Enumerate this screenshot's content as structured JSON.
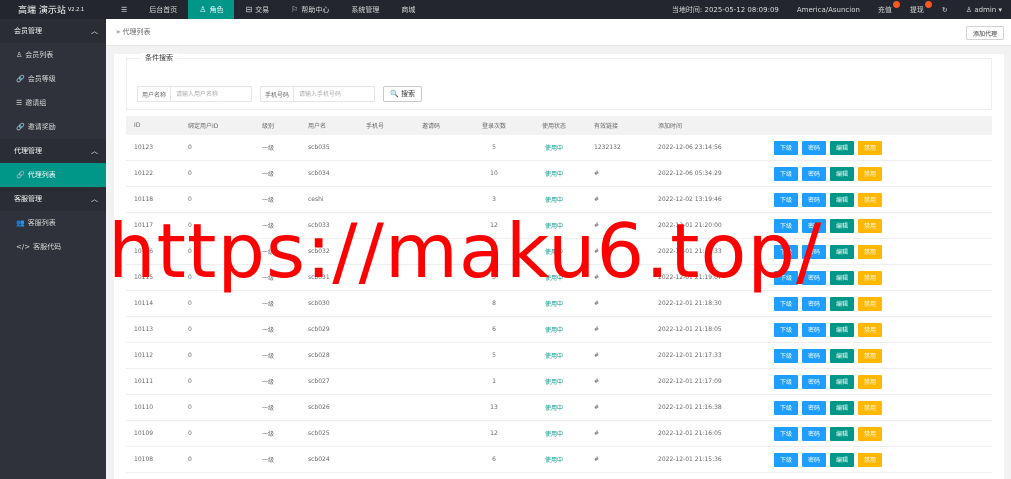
{
  "app": {
    "title": "高端 演示站",
    "version": "V2.2.1"
  },
  "topnav": {
    "menu_icon": "☰",
    "items": [
      {
        "label": "后台首页",
        "icon": "",
        "active": false
      },
      {
        "label": "角色",
        "icon": "♙",
        "active": true
      },
      {
        "label": "交易",
        "icon": "⊟",
        "active": false
      },
      {
        "label": "帮助中心",
        "icon": "⚐",
        "active": false
      },
      {
        "label": "系统管理",
        "icon": "",
        "active": false
      },
      {
        "label": "商城",
        "icon": "",
        "active": false
      }
    ],
    "time_label": "当地时间: 2025-05-12 08:09:09",
    "timezone": "America/Asuncion",
    "recharge": "充值",
    "withdraw": "提现",
    "refresh_icon": "↻",
    "user": "admin"
  },
  "sidebar": {
    "groups": [
      {
        "label": "会员管理",
        "items": [
          {
            "label": "会员列表",
            "icon": "♙",
            "active": false
          },
          {
            "label": "会员等级",
            "icon": "🔗",
            "active": false
          },
          {
            "label": "邀请组",
            "icon": "☰",
            "active": false
          },
          {
            "label": "邀请奖励",
            "icon": "🔗",
            "active": false
          }
        ]
      },
      {
        "label": "代理管理",
        "items": [
          {
            "label": "代理列表",
            "icon": "🔗",
            "active": true
          }
        ]
      },
      {
        "label": "客服管理",
        "items": [
          {
            "label": "客服列表",
            "icon": "👥",
            "active": false
          },
          {
            "label": "客服代码",
            "icon": "</>",
            "active": false
          }
        ]
      }
    ]
  },
  "tabbar": {
    "breadcrumb": "» 代理列表",
    "add_button": "添加代理"
  },
  "search": {
    "legend": "条件搜索",
    "username_label": "用户名称",
    "username_placeholder": "请输入用户名称",
    "phone_label": "手机号码",
    "phone_placeholder": "请输入手机号码",
    "search_button": "搜索",
    "search_icon": "🔍"
  },
  "table": {
    "headers": [
      "ID",
      "绑定用户ID",
      "级别",
      "用户名",
      "手机号",
      "邀请码",
      "登录次数",
      "使用状态",
      "有效链接",
      "添加时间"
    ],
    "rows": [
      {
        "id": "10123",
        "bind": "0",
        "level": "一级",
        "user": "scb035",
        "phone": "",
        "code": "",
        "login": "5",
        "status": "使用中",
        "link": "1232132",
        "time": "2022-12-06 23:14:56"
      },
      {
        "id": "10122",
        "bind": "0",
        "level": "一级",
        "user": "scb034",
        "phone": "",
        "code": "",
        "login": "10",
        "status": "使用中",
        "link": "#",
        "time": "2022-12-06 05:34:29"
      },
      {
        "id": "10118",
        "bind": "0",
        "level": "一级",
        "user": "ceshi",
        "phone": "",
        "code": "",
        "login": "3",
        "status": "使用中",
        "link": "#",
        "time": "2022-12-02 13:19:46"
      },
      {
        "id": "10117",
        "bind": "0",
        "level": "一级",
        "user": "scb033",
        "phone": "",
        "code": "",
        "login": "12",
        "status": "使用中",
        "link": "#",
        "time": "2022-12-01 21:20:00"
      },
      {
        "id": "10116",
        "bind": "0",
        "level": "一级",
        "user": "scb032",
        "phone": "",
        "code": "",
        "login": "0",
        "status": "使用中",
        "link": "#",
        "time": "2022-12-01 21:19:33"
      },
      {
        "id": "10115",
        "bind": "0",
        "level": "一级",
        "user": "scb031",
        "phone": "",
        "code": "",
        "login": "3",
        "status": "使用中",
        "link": "#",
        "time": "2022-12-01 21:19:07"
      },
      {
        "id": "10114",
        "bind": "0",
        "level": "一级",
        "user": "scb030",
        "phone": "",
        "code": "",
        "login": "8",
        "status": "使用中",
        "link": "#",
        "time": "2022-12-01 21:18:30"
      },
      {
        "id": "10113",
        "bind": "0",
        "level": "一级",
        "user": "scb029",
        "phone": "",
        "code": "",
        "login": "6",
        "status": "使用中",
        "link": "#",
        "time": "2022-12-01 21:18:05"
      },
      {
        "id": "10112",
        "bind": "0",
        "level": "一级",
        "user": "scb028",
        "phone": "",
        "code": "",
        "login": "5",
        "status": "使用中",
        "link": "#",
        "time": "2022-12-01 21:17:33"
      },
      {
        "id": "10111",
        "bind": "0",
        "level": "一级",
        "user": "scb027",
        "phone": "",
        "code": "",
        "login": "1",
        "status": "使用中",
        "link": "#",
        "time": "2022-12-01 21:17:09"
      },
      {
        "id": "10110",
        "bind": "0",
        "level": "一级",
        "user": "scb026",
        "phone": "",
        "code": "",
        "login": "13",
        "status": "使用中",
        "link": "#",
        "time": "2022-12-01 21:16:38"
      },
      {
        "id": "10109",
        "bind": "0",
        "level": "一级",
        "user": "scb025",
        "phone": "",
        "code": "",
        "login": "12",
        "status": "使用中",
        "link": "#",
        "time": "2022-12-01 21:16:05"
      },
      {
        "id": "10108",
        "bind": "0",
        "level": "一级",
        "user": "scb024",
        "phone": "",
        "code": "",
        "login": "6",
        "status": "使用中",
        "link": "#",
        "time": "2022-12-01 21:15:36"
      }
    ],
    "actions": [
      "下级",
      "密码",
      "编辑",
      "禁用"
    ]
  },
  "watermark": "https://maku6.top/",
  "colors": {
    "accent": "#009688",
    "blue": "#1e9fff",
    "orange": "#ffb800",
    "topbar": "#23262e",
    "sidebar": "#2f323a",
    "watermark": "#ff0000",
    "badge": "#ff5722"
  }
}
